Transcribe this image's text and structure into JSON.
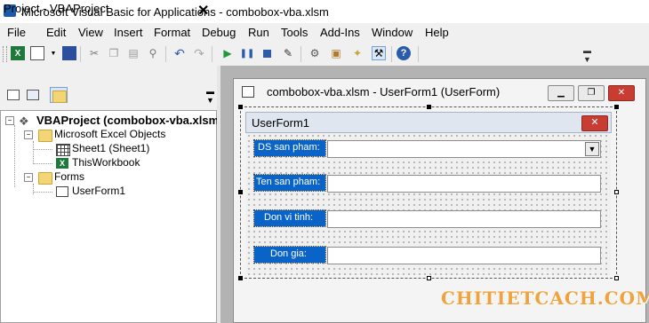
{
  "app": {
    "title": "Microsoft Visual Basic for Applications - combobox-vba.xlsm"
  },
  "menu": [
    "File",
    "Edit",
    "View",
    "Insert",
    "Format",
    "Debug",
    "Run",
    "Tools",
    "Add-Ins",
    "Window",
    "Help"
  ],
  "toolbar": {
    "icons": [
      "excel-icon",
      "insert-userform-icon",
      "save-icon",
      "cut-icon",
      "copy-icon",
      "paste-icon",
      "find-icon",
      "undo-icon",
      "redo-icon",
      "run-icon",
      "break-icon",
      "reset-icon",
      "design-mode-icon",
      "project-explorer-icon",
      "properties-icon",
      "object-browser-icon",
      "toolbox-icon",
      "help-icon"
    ]
  },
  "project": {
    "title": "Project - VBAProject",
    "tree": {
      "root": "VBAProject (combobox-vba.xlsm)",
      "excel_objects": "Microsoft Excel Objects",
      "sheet1": "Sheet1 (Sheet1)",
      "workbook": "ThisWorkbook",
      "forms": "Forms",
      "userform1": "UserForm1"
    }
  },
  "designer": {
    "title": "combobox-vba.xlsm - UserForm1 (UserForm)"
  },
  "form": {
    "caption": "UserForm1",
    "fields": [
      {
        "label": "DS san pham:",
        "type": "combobox"
      },
      {
        "label": "Ten san pham:",
        "type": "textbox"
      },
      {
        "label": "Don vi tinh:",
        "type": "textbox"
      },
      {
        "label": "Don gia:",
        "type": "textbox"
      }
    ]
  },
  "watermark": "CHITIETCACH.COM",
  "colors": {
    "label_bg": "#0a64c8",
    "close_red": "#c83c32",
    "watermark": "#f1a23c"
  }
}
